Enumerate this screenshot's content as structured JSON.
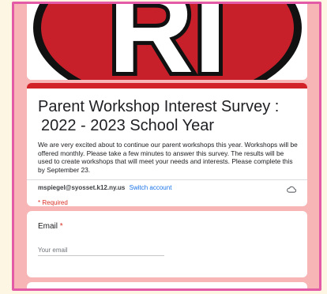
{
  "form": {
    "banner_letters": "RI",
    "title_line1": "Parent Workshop Interest Survey :",
    "title_line2": "2022 - 2023 School Year",
    "description": "We are very excited about to continue our parent workshops this year.  Workshops will be offered monthly.  Please take a few minutes to answer this survey.  The results will be used to create workshops that will meet your needs and interests.  Please complete this by September 23.",
    "account_email": "mspiegel@syosset.k12.ny.us",
    "switch_account": "Switch account",
    "required_note": "* Required"
  },
  "questions": [
    {
      "label": "Email",
      "required_mark": "*",
      "placeholder": "Your email"
    }
  ],
  "colors": {
    "accent": "#d22328",
    "frame_border": "#e35aa6",
    "background": "#f7b5b5",
    "link": "#1a73e8",
    "required": "#d93025"
  },
  "icons": {
    "cloud": "cloud-save-icon"
  }
}
